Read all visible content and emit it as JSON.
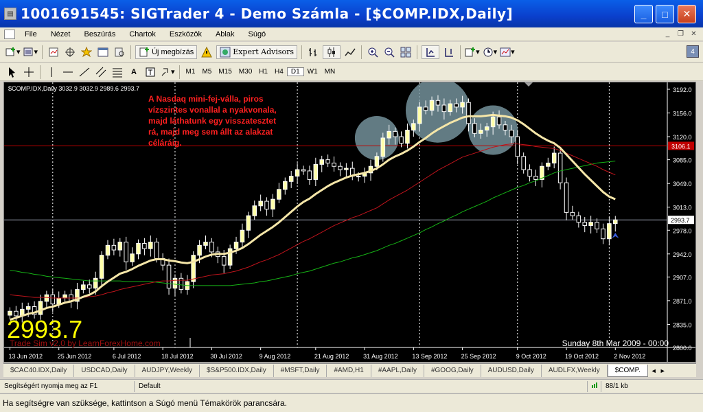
{
  "window": {
    "title": "1001691545: SIGTrader 4 - Demo Számla - [$COMP.IDX,Daily]"
  },
  "menu": [
    "File",
    "Nézet",
    "Beszúrás",
    "Chartok",
    "Eszközök",
    "Ablak",
    "Súgó"
  ],
  "toolbar1": {
    "new_order": "Új megbízás",
    "expert_advisors": "Expert Advisors",
    "badge": "4"
  },
  "periods": [
    "M1",
    "M5",
    "M15",
    "M30",
    "H1",
    "H4",
    "D1",
    "W1",
    "MN"
  ],
  "active_period": "D1",
  "chart": {
    "info": "$COMP.IDX,Daily  3032.9 3032.9 2989.6 2993.7",
    "annotation": [
      "A Nasdaq mini-fej-válla, piros",
      "vízszintes vonallal a nyakvonala,",
      "majd láthatunk egy visszatesztet",
      "rá, majd meg sem állt az alakzat",
      "céláráig."
    ],
    "big_price": "2993.7",
    "watermark": "Trade Sim v2.0 by LearnForexHome.com",
    "sim_date": "Sunday 8th Mar 2009 - 00:00",
    "red_line_label": "3106.1",
    "current_price_label": "2993.7",
    "colors": {
      "bull": "#ffffaa",
      "bear": "#ffffff",
      "ma_fast": "#f5e6a8",
      "ma_mid": "#c0141c",
      "ma_slow": "#16b316",
      "annotation": "#ff2020",
      "neckline": "#c00000",
      "circle": "#7a9aa4"
    }
  },
  "chart_data": {
    "type": "candlestick",
    "title": "",
    "y_ticks": [
      3192.0,
      3156.0,
      3120.0,
      3085.0,
      3049.0,
      3013.0,
      2978.0,
      2942.0,
      2907.0,
      2871.0,
      2835.0,
      2800.0
    ],
    "ylim": [
      2800,
      3192
    ],
    "x_ticks": [
      "13 Jun 2012",
      "25 Jun 2012",
      "6 Jul 2012",
      "18 Jul 2012",
      "30 Jul 2012",
      "9 Aug 2012",
      "21 Aug 2012",
      "31 Aug 2012",
      "13 Sep 2012",
      "25 Sep 2012",
      "9 Oct 2012",
      "19 Oct 2012",
      "2 Nov 2012"
    ],
    "neckline": 3106.1,
    "current_price": 2993.7,
    "closes": [
      2855,
      2848,
      2858,
      2862,
      2850,
      2870,
      2880,
      2866,
      2875,
      2880,
      2870,
      2888,
      2895,
      2890,
      2905,
      2940,
      2955,
      2948,
      2960,
      2930,
      2942,
      2958,
      2950,
      2960,
      2935,
      2925,
      2890,
      2905,
      2888,
      2900,
      2940,
      2955,
      2960,
      2945,
      2938,
      2925,
      2950,
      2960,
      2978,
      3000,
      3015,
      3022,
      3010,
      3025,
      3040,
      3052,
      3060,
      3070,
      3068,
      3055,
      3078,
      3085,
      3080,
      3075,
      3070,
      3072,
      3060,
      3060,
      3065,
      3075,
      3090,
      3118,
      3128,
      3120,
      3110,
      3130,
      3140,
      3165,
      3160,
      3175,
      3168,
      3158,
      3170,
      3165,
      3172,
      3140,
      3125,
      3130,
      3135,
      3150,
      3138,
      3130,
      3120,
      3090,
      3070,
      3060,
      3055,
      3075,
      3080,
      3095,
      3050,
      3005,
      3000,
      2990,
      2985,
      2990,
      2980,
      2965,
      2988,
      2993.7
    ],
    "ma_fast": [
      2842,
      2845,
      2848,
      2851,
      2853,
      2856,
      2860,
      2862,
      2865,
      2868,
      2870,
      2873,
      2877,
      2880,
      2885,
      2893,
      2900,
      2906,
      2912,
      2915,
      2919,
      2924,
      2928,
      2932,
      2934,
      2934,
      2932,
      2931,
      2929,
      2928,
      2930,
      2934,
      2938,
      2941,
      2942,
      2942,
      2944,
      2947,
      2951,
      2957,
      2964,
      2971,
      2977,
      2983,
      2990,
      2998,
      3006,
      3014,
      3021,
      3026,
      3033,
      3039,
      3045,
      3050,
      3054,
      3058,
      3061,
      3063,
      3065,
      3068,
      3072,
      3078,
      3085,
      3090,
      3094,
      3099,
      3105,
      3112,
      3118,
      3125,
      3131,
      3136,
      3141,
      3145,
      3149,
      3151,
      3151,
      3151,
      3152,
      3153,
      3152,
      3151,
      3149,
      3145,
      3139,
      3132,
      3125,
      3119,
      3114,
      3110,
      3103,
      3093,
      3083,
      3073,
      3063,
      3054,
      3045,
      3036,
      3029,
      3025
    ],
    "ma_mid": [
      2880,
      2879,
      2878,
      2877,
      2876,
      2876,
      2876,
      2875,
      2875,
      2875,
      2875,
      2875,
      2876,
      2877,
      2878,
      2880,
      2883,
      2885,
      2888,
      2890,
      2892,
      2894,
      2896,
      2898,
      2900,
      2901,
      2901,
      2902,
      2902,
      2902,
      2904,
      2906,
      2908,
      2910,
      2911,
      2912,
      2914,
      2916,
      2919,
      2922,
      2926,
      2930,
      2933,
      2937,
      2941,
      2946,
      2951,
      2956,
      2961,
      2965,
      2970,
      2975,
      2980,
      2985,
      2989,
      2993,
      2997,
      3000,
      3004,
      3008,
      3012,
      3018,
      3024,
      3029,
      3034,
      3039,
      3045,
      3051,
      3057,
      3063,
      3069,
      3074,
      3079,
      3084,
      3089,
      3092,
      3095,
      3098,
      3101,
      3104,
      3106,
      3108,
      3109,
      3109,
      3108,
      3107,
      3105,
      3104,
      3103,
      3102,
      3099,
      3095,
      3091,
      3087,
      3083,
      3079,
      3075,
      3070,
      3066,
      3062
    ],
    "ma_slow": [
      2917,
      2916,
      2914,
      2913,
      2911,
      2910,
      2908,
      2907,
      2906,
      2905,
      2904,
      2903,
      2902,
      2901,
      2901,
      2901,
      2901,
      2901,
      2901,
      2900,
      2900,
      2900,
      2900,
      2900,
      2899,
      2898,
      2897,
      2896,
      2895,
      2894,
      2894,
      2894,
      2894,
      2894,
      2894,
      2894,
      2894,
      2895,
      2896,
      2897,
      2898,
      2900,
      2901,
      2903,
      2905,
      2907,
      2909,
      2912,
      2914,
      2916,
      2919,
      2922,
      2925,
      2928,
      2930,
      2933,
      2936,
      2938,
      2941,
      2944,
      2947,
      2951,
      2955,
      2958,
      2962,
      2966,
      2970,
      2974,
      2979,
      2983,
      2988,
      2992,
      2997,
      3001,
      3006,
      3010,
      3014,
      3018,
      3022,
      3027,
      3031,
      3035,
      3039,
      3043,
      3046,
      3050,
      3053,
      3057,
      3061,
      3065,
      3068,
      3070,
      3072,
      3074,
      3076,
      3078,
      3080,
      3081,
      3082,
      3083
    ]
  },
  "tabs": [
    "$CAC40.IDX,Daily",
    "USDCAD,Daily",
    "AUDJPY,Weekly",
    "$S&P500.IDX,Daily",
    "#MSFT,Daily",
    "#AMD,H1",
    "#AAPL,Daily",
    "#GOOG,Daily",
    "AUDUSD,Daily",
    "AUDLFX,Weekly",
    "$COMP."
  ],
  "active_tab": "$COMP.",
  "status": {
    "help": "Segítségért nyomja meg az F1",
    "profile": "Default",
    "traffic": "88/1 kb"
  },
  "hint": "Ha segítségre van szüksége, kattintson a Súgó menü Témakörök parancsára."
}
